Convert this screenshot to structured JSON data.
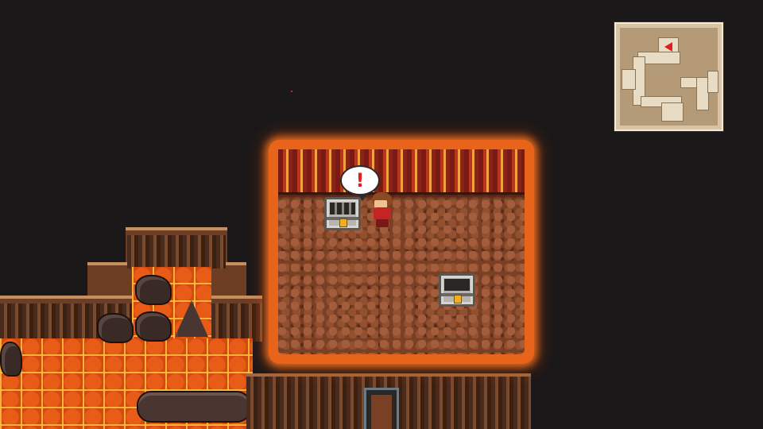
{
  "scene": {
    "location_type": "volcanic cave",
    "alert": {
      "icon": "exclamation-icon",
      "text": "!"
    },
    "chests": [
      {
        "state": "open",
        "icon": "open-chest-icon"
      },
      {
        "state": "closed",
        "icon": "closed-chest-icon"
      }
    ],
    "player": {
      "icon": "hero-sprite-icon"
    }
  },
  "minimap": {
    "marker_color": "#e02020",
    "marker_icon": "player-arrow-icon"
  },
  "colors": {
    "background": "#1a1819",
    "lava": "#d24a10",
    "room_glow": "#e8641a",
    "floor": "#7a4026",
    "minimap_paper": "#d8c4a4"
  }
}
